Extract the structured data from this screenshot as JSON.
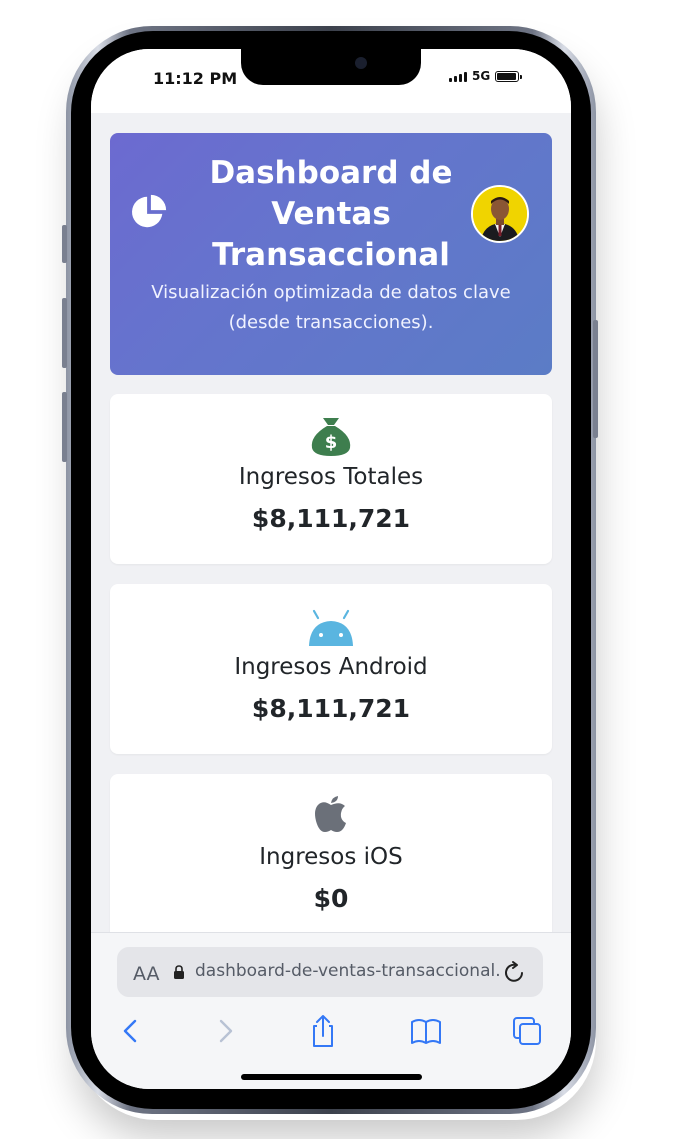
{
  "status_bar": {
    "time": "11:12 PM",
    "network": "5G",
    "icons": [
      "signal-bars-icon",
      "battery-icon"
    ]
  },
  "header": {
    "icon": "pie-chart-icon",
    "title": "Dashboard de Ventas Transaccional",
    "subtitle": "Visualización optimizada de datos clave (desde transacciones).",
    "avatar": "profile-avatar",
    "colors": {
      "gradient_start": "#6c6ad0",
      "gradient_end": "#5b7cc6"
    }
  },
  "kpis": [
    {
      "icon": "money-bag-icon",
      "icon_color": "#3e7e4e",
      "label": "Ingresos Totales",
      "value": "$8,111,721"
    },
    {
      "icon": "android-icon",
      "icon_color": "#5ab5e0",
      "label": "Ingresos Android",
      "value": "$8,111,721"
    },
    {
      "icon": "apple-icon",
      "icon_color": "#6b7079",
      "label": "Ingresos iOS",
      "value": "$0"
    }
  ],
  "browser": {
    "text_size_label": "AA",
    "url": "dashboard-de-ventas-transaccional.v",
    "icons": [
      "lock-icon",
      "reload-icon",
      "back-icon",
      "forward-icon",
      "share-icon",
      "bookmarks-icon",
      "tabs-icon"
    ],
    "accent": "#3478f6"
  }
}
